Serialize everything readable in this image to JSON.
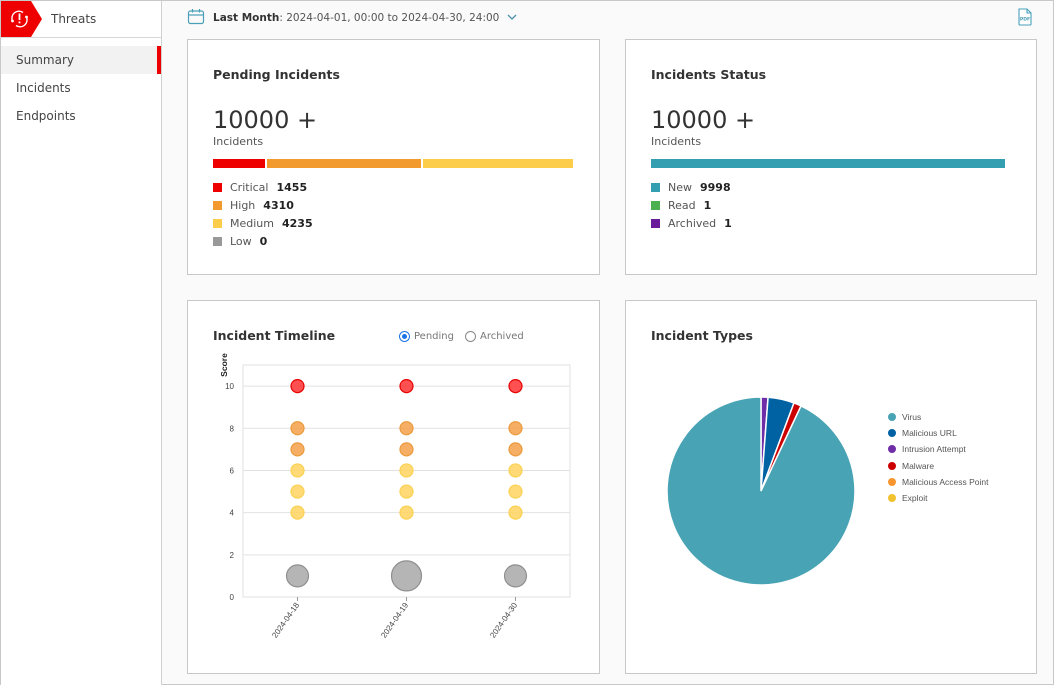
{
  "app": {
    "section_title": "Threats",
    "brand_icon": "threat-refresh-icon",
    "brand_color": "#ee0000"
  },
  "sidebar": {
    "items": [
      {
        "label": "Summary",
        "active": true
      },
      {
        "label": "Incidents",
        "active": false
      },
      {
        "label": "Endpoints",
        "active": false
      }
    ]
  },
  "topbar": {
    "calendar_icon": "calendar-icon",
    "range_label": "Last Month",
    "range_value": "2024-04-01, 00:00 to 2024-04-30, 24:00",
    "dropdown_icon": "chevron-down-icon",
    "export_icon": "pdf-export-icon"
  },
  "pending": {
    "title": "Pending Incidents",
    "total": "10000 +",
    "total_label": "Incidents",
    "segments": [
      {
        "name": "Critical",
        "value": 1455,
        "color": "#ee0000"
      },
      {
        "name": "High",
        "value": 4310,
        "color": "#f29a2e"
      },
      {
        "name": "Medium",
        "value": 4235,
        "color": "#fccd4a"
      },
      {
        "name": "Low",
        "value": 0,
        "color": "#999999"
      }
    ]
  },
  "status": {
    "title": "Incidents Status",
    "total": "10000 +",
    "total_label": "Incidents",
    "segments": [
      {
        "name": "New",
        "value": 9998,
        "color": "#349fb0"
      },
      {
        "name": "Read",
        "value": 1,
        "color": "#4caf50"
      },
      {
        "name": "Archived",
        "value": 1,
        "color": "#6a1b9a"
      }
    ]
  },
  "timeline": {
    "title": "Incident Timeline",
    "filters": [
      {
        "label": "Pending",
        "selected": true
      },
      {
        "label": "Archived",
        "selected": false
      }
    ]
  },
  "types": {
    "title": "Incident Types"
  },
  "chart_data": [
    {
      "type": "scatter",
      "title": "Incident Timeline",
      "xlabel": "",
      "ylabel": "Score",
      "categories": [
        "2024-04-18",
        "2024-04-19",
        "2024-04-30"
      ],
      "yticks": [
        0,
        2,
        4,
        6,
        8,
        10
      ],
      "ylim": [
        0,
        11
      ],
      "grid": true,
      "series": [
        {
          "name": "Critical",
          "color": "#ff3333",
          "points": [
            {
              "x": "2024-04-18",
              "y": 10,
              "size": 1
            },
            {
              "x": "2024-04-19",
              "y": 10,
              "size": 1
            },
            {
              "x": "2024-04-30",
              "y": 10,
              "size": 1
            }
          ]
        },
        {
          "name": "High",
          "color": "#f5a04a",
          "points": [
            {
              "x": "2024-04-18",
              "y": 8,
              "size": 1
            },
            {
              "x": "2024-04-19",
              "y": 8,
              "size": 1
            },
            {
              "x": "2024-04-30",
              "y": 8,
              "size": 1
            },
            {
              "x": "2024-04-18",
              "y": 7,
              "size": 1
            },
            {
              "x": "2024-04-19",
              "y": 7,
              "size": 1
            },
            {
              "x": "2024-04-30",
              "y": 7,
              "size": 1
            }
          ]
        },
        {
          "name": "Medium",
          "color": "#ffd45e",
          "points": [
            {
              "x": "2024-04-18",
              "y": 6,
              "size": 1
            },
            {
              "x": "2024-04-19",
              "y": 6,
              "size": 1
            },
            {
              "x": "2024-04-30",
              "y": 6,
              "size": 1
            },
            {
              "x": "2024-04-18",
              "y": 5,
              "size": 1
            },
            {
              "x": "2024-04-19",
              "y": 5,
              "size": 1
            },
            {
              "x": "2024-04-30",
              "y": 5,
              "size": 1
            },
            {
              "x": "2024-04-18",
              "y": 4,
              "size": 1
            },
            {
              "x": "2024-04-19",
              "y": 4,
              "size": 1
            },
            {
              "x": "2024-04-30",
              "y": 4,
              "size": 1
            }
          ]
        },
        {
          "name": "Low",
          "color": "#a8a8a8",
          "points": [
            {
              "x": "2024-04-18",
              "y": 1,
              "size": 2
            },
            {
              "x": "2024-04-19",
              "y": 1,
              "size": 3
            },
            {
              "x": "2024-04-30",
              "y": 1,
              "size": 2
            }
          ]
        }
      ]
    },
    {
      "type": "pie",
      "title": "Incident Types",
      "legend_position": "right",
      "slices": [
        {
          "name": "Virus",
          "value": 93,
          "color": "#48a3b4"
        },
        {
          "name": "Malicious URL",
          "value": 4.5,
          "color": "#0062a3"
        },
        {
          "name": "Intrusion Attempt",
          "value": 1.2,
          "color": "#6f2da8"
        },
        {
          "name": "Malware",
          "value": 1.3,
          "color": "#cc0000"
        },
        {
          "name": "Malicious Access Point",
          "value": 0,
          "color": "#f7962f"
        },
        {
          "name": "Exploit",
          "value": 0,
          "color": "#f2c12e"
        }
      ],
      "draw_order": [
        "Intrusion Attempt",
        "Malicious URL",
        "Malware",
        "Virus",
        "Malicious Access Point",
        "Exploit"
      ]
    }
  ]
}
